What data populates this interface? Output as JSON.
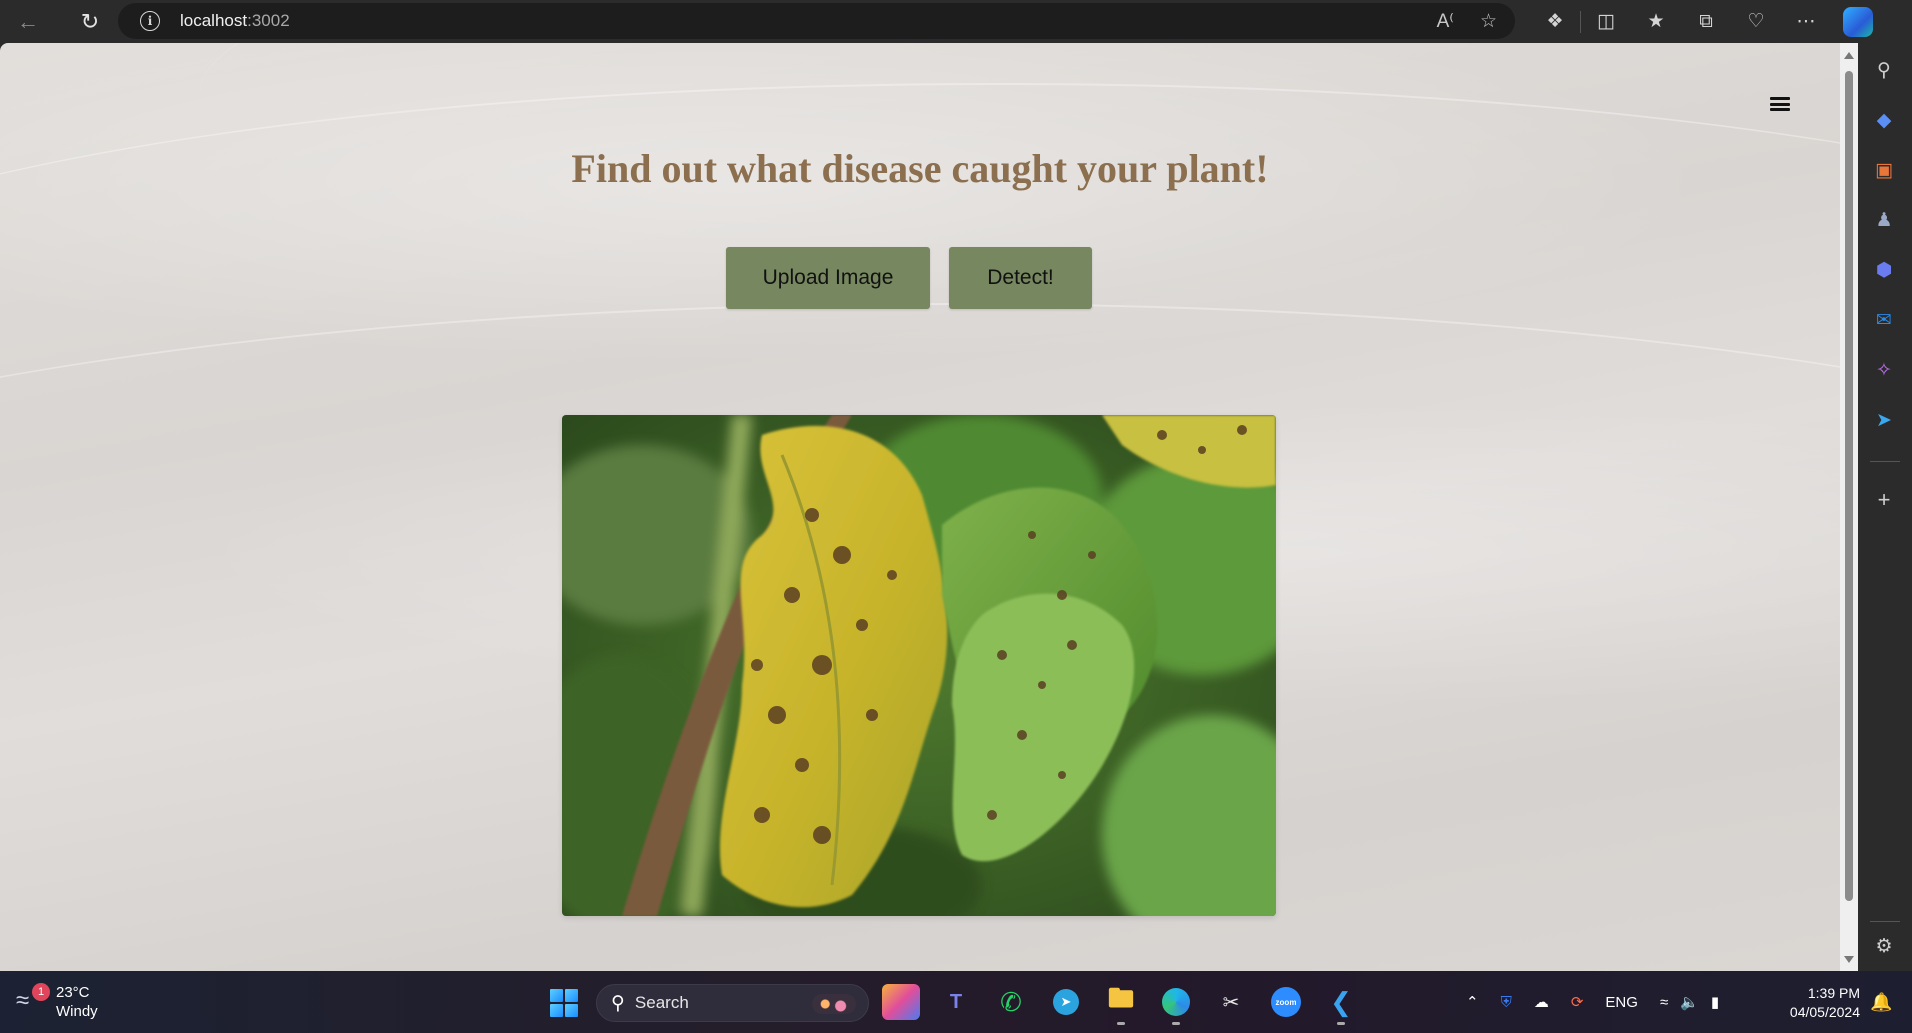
{
  "browser": {
    "url_host": "localhost",
    "url_port": ":3002",
    "back_icon": "back-arrow-icon",
    "refresh_icon": "refresh-icon"
  },
  "page": {
    "title": "Find out what disease caught your plant!",
    "upload_button": "Upload Image",
    "detect_button": "Detect!",
    "menu_icon": "hamburger-menu-icon",
    "title_color": "#8b6f4e",
    "button_color": "#77875f"
  },
  "taskbar": {
    "weather_temp": "23°C",
    "weather_desc": "Windy",
    "weather_badge": "1",
    "search_label": "Search",
    "language": "ENG",
    "time": "1:39 PM",
    "date": "04/05/2024"
  }
}
